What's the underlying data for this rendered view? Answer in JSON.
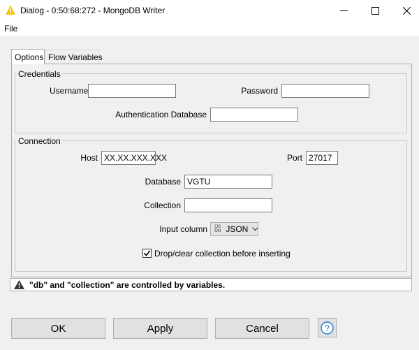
{
  "window": {
    "title": "Dialog - 0:50:68:272 - MongoDB Writer",
    "icon": "warning-triangle-icon",
    "minimize_icon": "minimize-icon",
    "maximize_icon": "maximize-icon",
    "close_icon": "close-icon"
  },
  "menu": {
    "file": "File"
  },
  "tabs": [
    {
      "label": "Options",
      "active": true
    },
    {
      "label": "Flow Variables",
      "active": false
    }
  ],
  "credentials": {
    "legend": "Credentials",
    "username_label": "Username",
    "username_value": "",
    "password_label": "Password",
    "password_value": "",
    "auth_db_label": "Authentication Database",
    "auth_db_value": ""
  },
  "connection": {
    "legend": "Connection",
    "host_label": "Host",
    "host_value": "XX.XX.XXX.XXX",
    "port_label": "Port",
    "port_value": "27017",
    "database_label": "Database",
    "database_value": "VGTU",
    "collection_label": "Collection",
    "collection_value": "",
    "input_column_label": "Input column",
    "input_column_icon_top": "{JS",
    "input_column_icon_bottom": "ON",
    "input_column_value": "JSON",
    "drop_checkbox_label": "Drop/clear collection before inserting",
    "drop_checkbox_checked": true
  },
  "status": {
    "icon": "warning-icon",
    "text": "\"db\" and \"collection\" are controlled by variables."
  },
  "buttons": {
    "ok": "OK",
    "apply": "Apply",
    "cancel": "Cancel",
    "help_icon": "help-icon"
  },
  "colors": {
    "title_icon": "#f2c500",
    "help_icon": "#1f7ad1",
    "warning": "#333333"
  }
}
